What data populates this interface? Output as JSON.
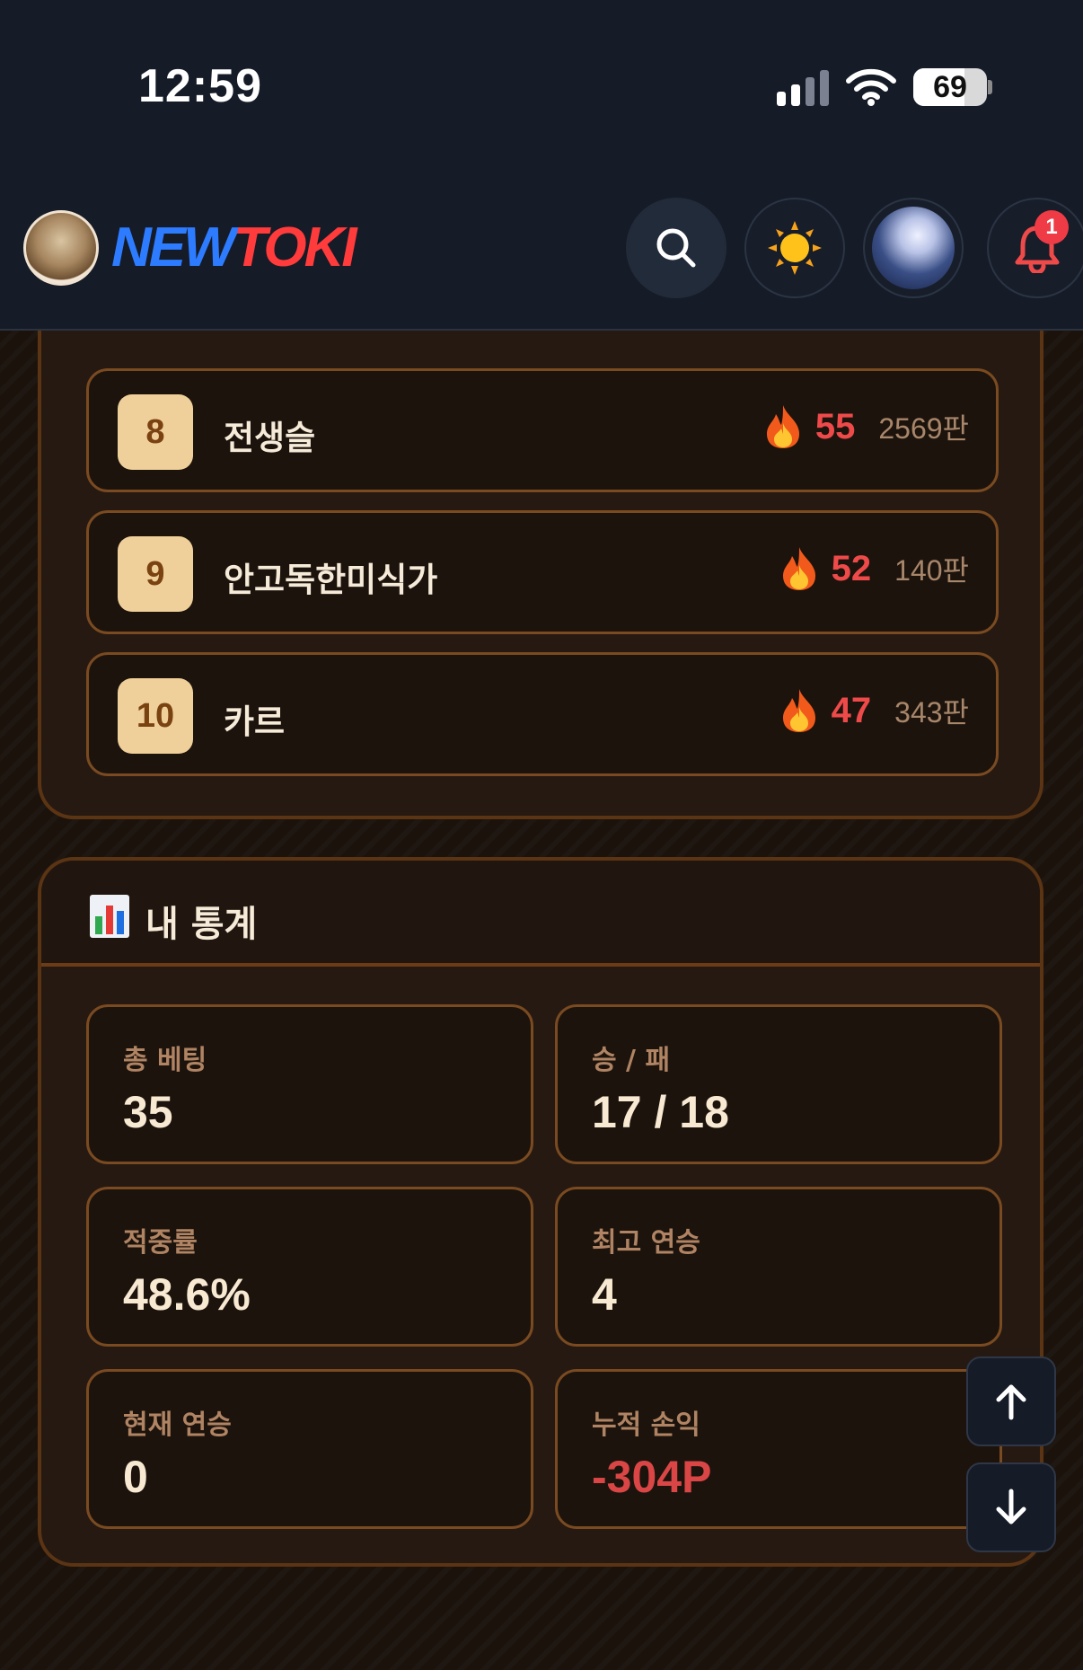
{
  "status_bar": {
    "time": "12:59",
    "battery": "69",
    "battery_level": 0.69
  },
  "header": {
    "logo": {
      "part1": "NEW",
      "part2": "TOKI"
    },
    "notification_count": "1",
    "colors": {
      "logo_blue": "#2d7cff",
      "logo_red": "#ff3b3b",
      "badge": "#ef3b45"
    }
  },
  "ranking": {
    "rows": [
      {
        "rank": "8",
        "name": "전생슬",
        "score": "55",
        "games": "2569판"
      },
      {
        "rank": "9",
        "name": "안고독한미식가",
        "score": "52",
        "games": "140판"
      },
      {
        "rank": "10",
        "name": "카르",
        "score": "47",
        "games": "343판"
      }
    ]
  },
  "stats": {
    "title": "내 통계",
    "items": [
      {
        "label": "총 베팅",
        "value": "35"
      },
      {
        "label": "승 / 패",
        "value": "17 / 18"
      },
      {
        "label": "적중률",
        "value": "48.6%"
      },
      {
        "label": "최고 연승",
        "value": "4"
      },
      {
        "label": "현재 연승",
        "value": "0"
      },
      {
        "label": "누적 손익",
        "value": "-304P"
      }
    ]
  },
  "icons": [
    "search-icon",
    "sun-icon",
    "bell-icon",
    "fire-icon",
    "bar-chart-icon",
    "arrow-up-icon",
    "arrow-down-icon"
  ]
}
